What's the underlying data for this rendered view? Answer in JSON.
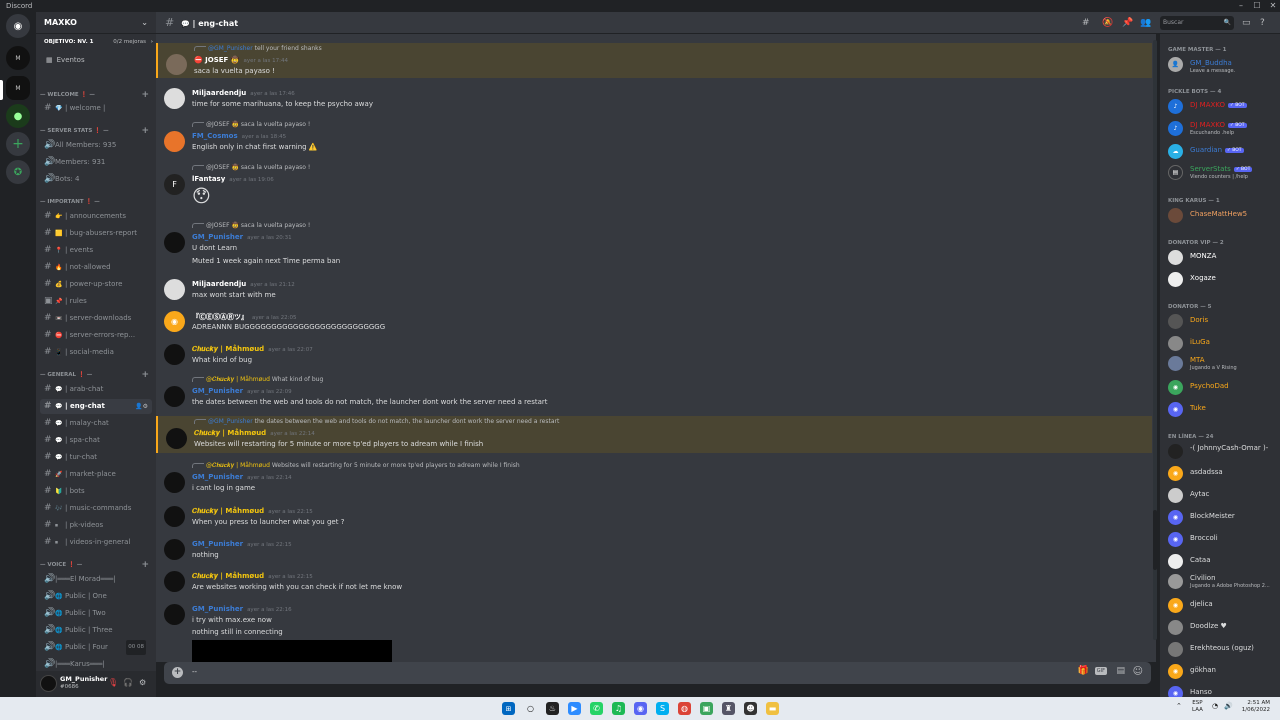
{
  "app": {
    "title": "Discord"
  },
  "server": {
    "name": "MAXKO",
    "goal_label": "OBJETIVO: NV. 1",
    "goal_progress": "0/2 mejoras",
    "events_label": "Eventos"
  },
  "channels": {
    "welcome_cat": "WELCOME",
    "welcome": "| welcome |",
    "stats_cat": "SERVER STATS",
    "all_members": "All Members: 935",
    "members": "Members: 931",
    "bots": "Bots: 4",
    "important_cat": "IMPORTANT",
    "announcements": "| announcements",
    "bug_abusers": "| bug-abusers-report",
    "events": "| events",
    "not_allowed": "| not-allowed",
    "power_up": "| power-up-store",
    "rules": "| rules",
    "server_downloads": "| server-downloads",
    "server_errors": "| server-errors-rep...",
    "social_media": "| social-media",
    "general_cat": "GENERAL",
    "arab_chat": "| arab-chat",
    "eng_chat": "| eng-chat",
    "malay_chat": "| malay-chat",
    "spa_chat": "| spa-chat",
    "tur_chat": "| tur-chat",
    "market_place": "| market-place",
    "bots_ch": "| bots",
    "music_commands": "| music-commands",
    "pk_videos": "| pk-videos",
    "videos_in_general": "| videos-in-general",
    "voice_cat": "VOICE",
    "el_morad": "|═══El Morad═══|",
    "public_one": "Public | One",
    "public_two": "Public | Two",
    "public_three": "Public | Three",
    "public_four": "Public | Four",
    "public_four_count_a": "00",
    "public_four_count_b": "08",
    "karus": "|═══Karus═══|"
  },
  "user": {
    "name": "GM_Punisher",
    "tag": "#0686"
  },
  "header": {
    "channel": "| eng-chat",
    "search_placeholder": "Buscar"
  },
  "messages": [
    {
      "reply_author": "@GM_Punisher",
      "reply_text": "tell your friend shanks",
      "author": "JOSEF",
      "ts": "ayer a las 17:44",
      "lines": [
        "saca la vuelta payaso !"
      ]
    },
    {
      "author": "Miljaardendju",
      "ts": "ayer a las 17:46",
      "lines": [
        "time for some marihuana, to keep the psycho away"
      ]
    },
    {
      "reply_author": "@JOSEF",
      "reply_text": "saca la vuelta payaso !",
      "author": "FM_Cosmos",
      "ts": "ayer a las 18:45",
      "lines": [
        "English only in chat first warning ⚠️"
      ]
    },
    {
      "reply_author": "@JOSEF",
      "reply_text": "saca la vuelta payaso !",
      "author": "lFantasy",
      "ts": "ayer a las 19:06",
      "lines": [
        "😯"
      ]
    },
    {
      "reply_author": "@JOSEF",
      "reply_text": "saca la vuelta payaso !",
      "author": "GM_Punisher",
      "ts": "ayer a las 20:31",
      "lines": [
        "U dont Learn",
        "Muted 1 week again next Time perma ban"
      ]
    },
    {
      "author": "Miljaardendju",
      "ts": "ayer a las 21:12",
      "lines": [
        "max wont start with me"
      ]
    },
    {
      "author": "『ⒸⒺⓈⒶⓇツ』",
      "ts": "ayer a las 22:05",
      "lines": [
        "ADREANNN BUGGGGGGGGGGGGGGGGGGGGGGGGGG"
      ]
    },
    {
      "author": "𝑪𝒉𝒖𝒄𝒌𝒚 | Måhmøud",
      "ts": "ayer a las 22:07",
      "lines": [
        "What kind of bug"
      ]
    },
    {
      "reply_author": "@𝑪𝒉𝒖𝒄𝒌𝒚 | Måhmøud",
      "reply_text": "What kind of bug",
      "author": "GM_Punisher",
      "ts": "ayer a las 22:09",
      "lines": [
        "the dates between the web and tools do not match, the launcher dont work the server need a restart"
      ]
    },
    {
      "reply_author": "@GM_Punisher",
      "reply_text": "the dates between the web and tools do not match, the launcher dont work the server need a restart",
      "author": "𝑪𝒉𝒖𝒄𝒌𝒚 | Måhmøud",
      "ts": "ayer a las 22:14",
      "lines": [
        "Websites will restarting for 5 minute or more tp'ed players to adream while I finish"
      ]
    },
    {
      "reply_author": "@𝑪𝒉𝒖𝒄𝒌𝒚 | Måhmøud",
      "reply_text": "Websites will restarting for 5 minute or more tp'ed players to adream while I finish",
      "author": "GM_Punisher",
      "ts": "ayer a las 22:14",
      "lines": [
        "i cant log in game"
      ]
    },
    {
      "author": "𝑪𝒉𝒖𝒄𝒌𝒚 | Måhmøud",
      "ts": "ayer a las 22:15",
      "lines": [
        "When you press to launcher what you get ?"
      ]
    },
    {
      "author": "GM_Punisher",
      "ts": "ayer a las 22:15",
      "lines": [
        "nothing"
      ]
    },
    {
      "author": "𝑪𝒉𝒖𝒄𝒌𝒚 | Måhmøud",
      "ts": "ayer a las 22:15",
      "lines": [
        "Are websites working with you can check if not let me know"
      ]
    },
    {
      "author": "GM_Punisher",
      "ts": "ayer a las 22:16",
      "lines": [
        "i try with max.exe now",
        "nothing still in connecting"
      ]
    }
  ],
  "composer": {
    "value": "--"
  },
  "member_list": {
    "gm_cat": "GAME MASTER — 1",
    "gm_buddha": "GM_Buddha",
    "gm_buddha_status": "Leave a message.",
    "pickle_cat": "PICKLE BOTS — 4",
    "dj_maxko1": "DJ MAXKO",
    "dj_maxko2": "DJ MAXKO",
    "dj_maxko2_status": "Escuchando .help",
    "guardian": "Guardian",
    "serverstats": "ServerStats",
    "serverstats_status": "Viendo counters | /help",
    "bot_tag": "✓ BOT",
    "king_cat": "KING KARUS — 1",
    "chase": "ChaseMattHew5",
    "vip_cat": "DONATOR VIP — 2",
    "monza": "MONZA",
    "xogaze": "Xogaze",
    "donator_cat": "DONATOR — 5",
    "doris": "Doris",
    "iluga": "iLuGa",
    "mta": "MTA",
    "mta_status": "Jugando a V Rising",
    "psychodad": "PsychoDad",
    "tuke": "Tuke",
    "online_cat": "EN LÍNEA — 24",
    "johnny": "-( JohnnyCash-Omar )-",
    "asdadssa": "asdadssa",
    "aytac": "Aytac",
    "blockmeister": "BlockMeister",
    "broccoli": "Broccoli",
    "cataa": "Cataa",
    "civilion": "Civilion",
    "civilion_status": "Jugando a Adobe Photoshop 2...",
    "djelica": "djelica",
    "doodlze": "Doodlze ♥",
    "erekhteous": "Erekhteous (oguz)",
    "gokhan": "gökhan",
    "hanso": "Hanso"
  },
  "taskbar": {
    "lang": "ESP",
    "lang2": "LAA",
    "time": "2:51 AM",
    "date": "1/06/2022"
  },
  "colors": {
    "accent": "#5865f2",
    "highlight": "#faa81a",
    "gm_blue": "#3c7cd4",
    "chucky_gold": "#f1c40f"
  }
}
